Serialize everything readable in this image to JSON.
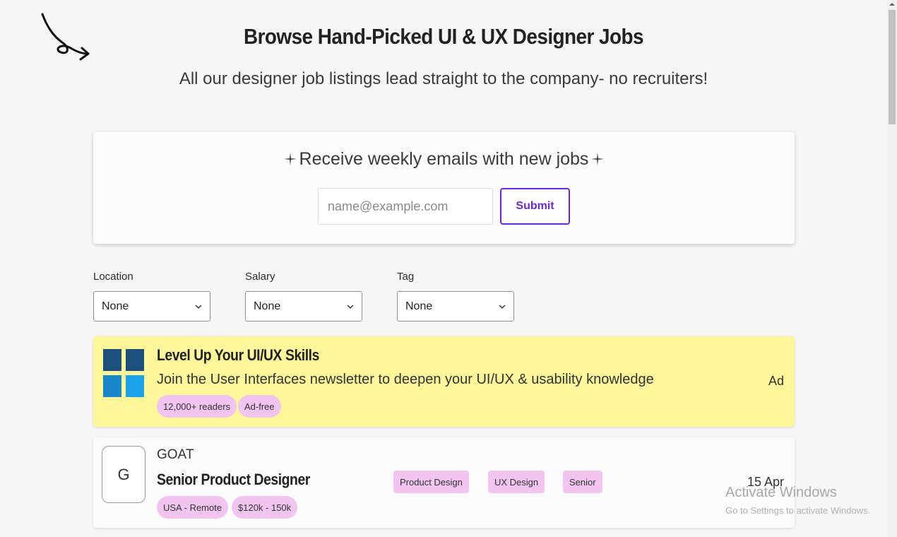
{
  "header": {
    "title": "Browse Hand-Picked UI & UX Designer Jobs",
    "subtitle": "All our designer job listings lead straight to the company- no recruiters!"
  },
  "newsletter": {
    "heading": "Receive weekly emails with new jobs",
    "email_placeholder": "name@example.com",
    "submit_label": "Submit",
    "accent_color": "#6d28d9"
  },
  "filters": [
    {
      "label": "Location",
      "value": "None"
    },
    {
      "label": "Salary",
      "value": "None"
    },
    {
      "label": "Tag",
      "value": "None"
    }
  ],
  "ad": {
    "title": "Level Up Your UI/UX Skills",
    "description": "Join the User Interfaces newsletter to deepen your UI/UX & usability knowledge",
    "tags": [
      "12,000+ readers",
      "Ad-free"
    ],
    "label": "Ad",
    "background": "#fdf69a"
  },
  "jobs": [
    {
      "logo_letter": "G",
      "company": "GOAT",
      "title": "Senior Product Designer",
      "tags": [
        "Product Design",
        "UX Design",
        "Senior"
      ],
      "meta": [
        "USA - Remote",
        "$120k - 150k"
      ],
      "date": "15 Apr"
    }
  ],
  "watermark": {
    "title": "Activate Windows",
    "subtitle": "Go to Settings to activate Windows."
  },
  "pill_color": "#f2c4f0"
}
